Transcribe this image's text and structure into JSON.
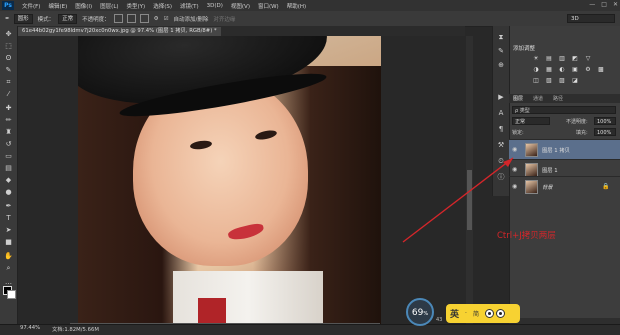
{
  "app": {
    "logo": "Ps"
  },
  "menu": [
    "文件(F)",
    "编辑(E)",
    "图像(I)",
    "图层(L)",
    "类型(Y)",
    "选择(S)",
    "滤镜(T)",
    "3D(D)",
    "视图(V)",
    "窗口(W)",
    "帮助(H)"
  ],
  "window_controls": [
    "—",
    "□",
    "✕"
  ],
  "options_bar": {
    "size_select": "圆形",
    "mode_label": "模式：",
    "mode_value": "正常",
    "opacity_label": "不透明度：",
    "flow_label": "流量：",
    "auto_add": "自动添加/删除",
    "align_edges": "对齐边缘"
  },
  "workspace_select": "3D",
  "document_tab": "61e44b02gy1fe98ldmv7j20xc0n0wx.jpg @ 97.4% (图层 1 拷贝, RGB/8#) *",
  "panels": {
    "adjustments_title": "添加调整",
    "adjustment_icons": [
      "☀",
      "▤",
      "▥",
      "◩",
      "▽",
      "◑",
      "▦",
      "◐",
      "▣",
      "⚙",
      "▩",
      "◫",
      "▧",
      "▨",
      "◪"
    ],
    "layers_tabs": [
      "图层",
      "通道",
      "路径"
    ],
    "filter_label": "ρ 类型",
    "blend_mode": "正常",
    "opacity_label": "不透明度:",
    "opacity_value": "100%",
    "lock_label": "锁定:",
    "fill_label": "填充:",
    "fill_value": "100%",
    "layers": [
      {
        "name": "图层 1 拷贝",
        "selected": true
      },
      {
        "name": "图层 1",
        "selected": false
      },
      {
        "name": "背景",
        "selected": false
      }
    ]
  },
  "status": {
    "zoom": "97.44%",
    "doc": "文档:1.82M/5.66M"
  },
  "annotation": "Ctrl+J拷贝两层",
  "perf_gauge": {
    "value": "69",
    "unit": "%",
    "sub": "43"
  },
  "ime": {
    "lang": "英",
    "sep": "·",
    "mode": "简"
  },
  "colors": {
    "annotation": "#d4262a",
    "ime_bar": "#f7d232",
    "selected_layer": "#5b6f8c"
  }
}
